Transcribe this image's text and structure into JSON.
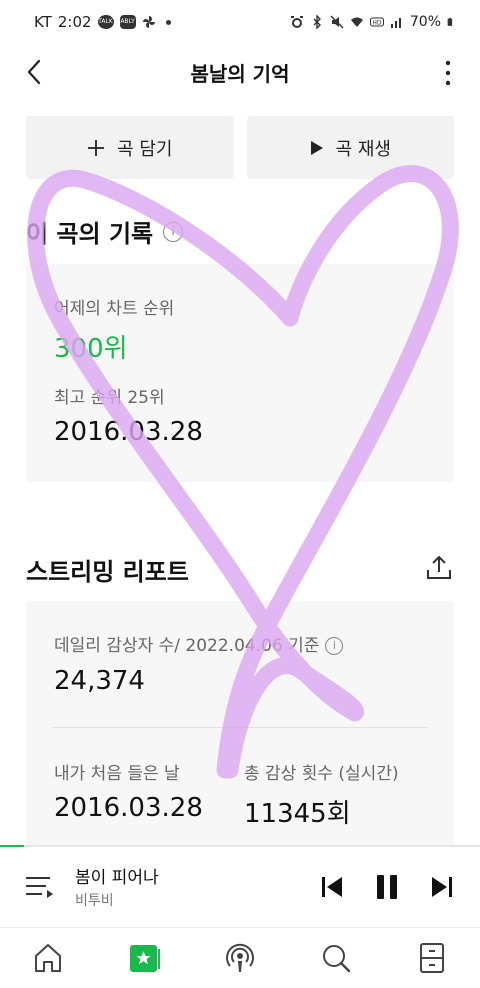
{
  "status_bar": {
    "carrier": "KT",
    "time": "2:02",
    "battery": "70%",
    "badge1": "TALK",
    "badge2": "ABLY"
  },
  "header": {
    "title": "봄날의 기억"
  },
  "actions": {
    "add_label": "곡 담기",
    "play_label": "곡 재생"
  },
  "record": {
    "heading": "이 곡의 기록",
    "info_glyph": "i",
    "yesterday_label": "어제의 차트 순위",
    "yesterday_rank": "300위",
    "best_label": "최고 순위 25위",
    "best_date": "2016.03.28"
  },
  "streaming": {
    "heading": "스트리밍 리포트",
    "daily_label": "데일리 감상자 수/ 2022.04.06 기준",
    "daily_value": "24,374",
    "first_label": "내가 처음 들은 날",
    "first_value": "2016.03.28",
    "total_label": "총 감상 횟수 (실시간)",
    "total_value": "11345회"
  },
  "player": {
    "song_title": "봄이 피어나",
    "artist": "비투비",
    "progress_fraction": 0.05
  },
  "colors": {
    "accent": "#19b94b",
    "heart_stroke": "#d9a6f0"
  },
  "nav": {
    "items": [
      "home-icon",
      "my-music-icon",
      "podcast-icon",
      "search-icon",
      "storage-icon"
    ]
  }
}
